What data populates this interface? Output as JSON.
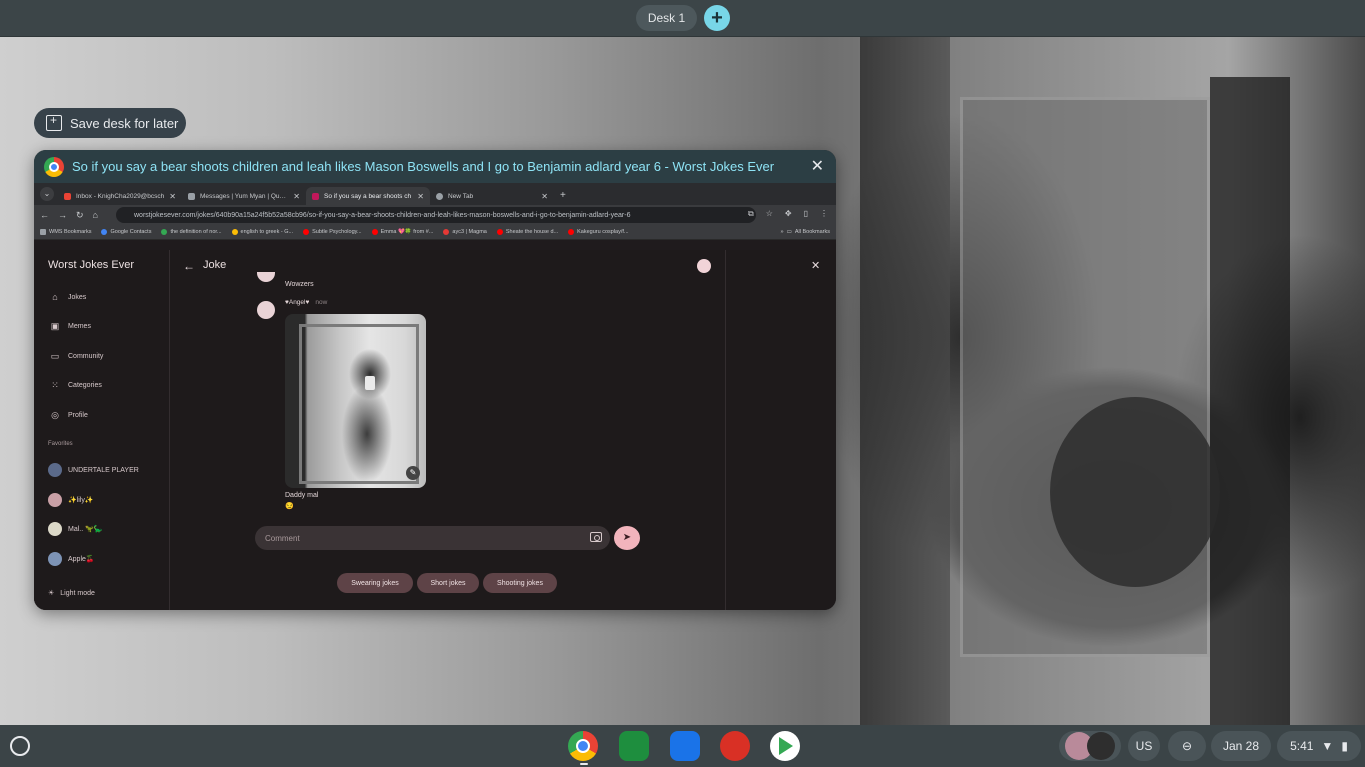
{
  "desk_bar": {
    "desk_label": "Desk 1",
    "add_label": "+"
  },
  "save_desk": {
    "label": "Save desk for later"
  },
  "window": {
    "title": "So if you say a bear shoots children and leah likes Mason Boswells and I go to Benjamin adlard year 6 - Worst Jokes Ever",
    "close": "✕"
  },
  "tabs": [
    {
      "label": "Inbox - KnighCha2029@bcsch",
      "favicon_color": "#ea4335"
    },
    {
      "label": "Messages | Yum Myan | Quotev",
      "favicon_color": "#9aa0a6"
    },
    {
      "label": "So if you say a bear shoots ch",
      "favicon_color": "#c2185b"
    },
    {
      "label": "New Tab",
      "favicon_color": "#9aa0a6"
    }
  ],
  "toolbar": {
    "url": "worstjokesever.com/jokes/640b90a15a24f5b52a58cb96/so-if-you-say-a-bear-shoots-children-and-leah-likes-mason-boswells-and-i-go-to-benjamin-adlard-year-6"
  },
  "bookmarks": [
    {
      "label": "WMS Bookmarks",
      "color": "#9aa0a6"
    },
    {
      "label": "Google Contacts",
      "color": "#4285f4"
    },
    {
      "label": "the definition of nor...",
      "color": "#34a853"
    },
    {
      "label": "english to greek - G...",
      "color": "#fbbc05"
    },
    {
      "label": "Subtle Psychology...",
      "color": "#ff0000"
    },
    {
      "label": "Emma 💖🍀 from #...",
      "color": "#ff0000"
    },
    {
      "label": "ayc3 | Magma",
      "color": "#e53935"
    },
    {
      "label": "Sheate the house d...",
      "color": "#ff0000"
    },
    {
      "label": "Kakeguru cosplay/f...",
      "color": "#ff0000"
    }
  ],
  "bookmarks_all": "All Bookmarks",
  "site": {
    "brand": "Worst Jokes Ever",
    "nav": [
      {
        "label": "Jokes",
        "icon": "home-icon"
      },
      {
        "label": "Memes",
        "icon": "image-icon"
      },
      {
        "label": "Community",
        "icon": "chat-icon"
      },
      {
        "label": "Categories",
        "icon": "grid-icon"
      },
      {
        "label": "Profile",
        "icon": "person-icon"
      }
    ],
    "favorites_heading": "Favorites",
    "favorites": [
      {
        "label": "UNDERTALE PLAYER"
      },
      {
        "label": "✨lily✨"
      },
      {
        "label": "Mal.. 🦖🦕"
      },
      {
        "label": "Apple🍒"
      }
    ],
    "light_mode": "Light mode"
  },
  "joke_pane": {
    "title": "Joke",
    "comments": [
      {
        "text": "Wowzers"
      },
      {
        "author": "♥Angel♥",
        "time": "now",
        "caption": "Daddy mal",
        "emoji": "😏"
      }
    ],
    "comment_placeholder": "Comment",
    "chips": [
      "Swearing jokes",
      "Short jokes",
      "Shooting jokes"
    ]
  },
  "shelf": {
    "keyboard": "US",
    "date": "Jan 28",
    "time": "5:41"
  }
}
